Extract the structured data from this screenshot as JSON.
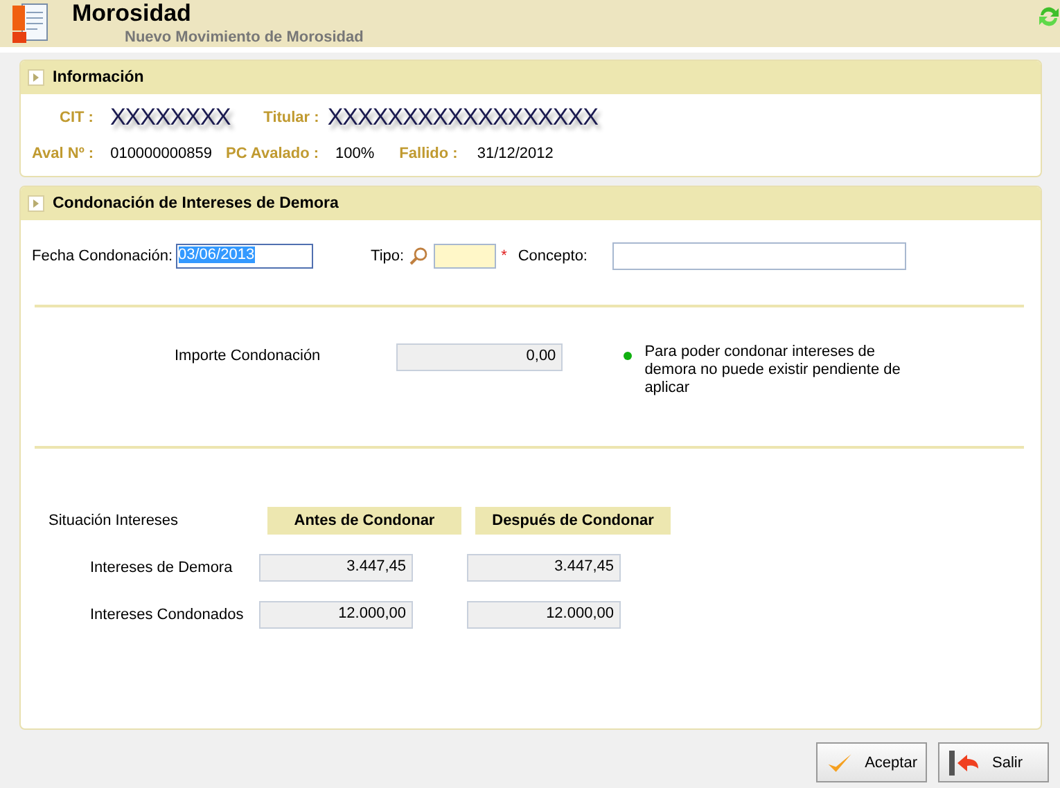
{
  "header": {
    "title": "Morosidad",
    "subtitle": "Nuevo Movimiento de Morosidad"
  },
  "info": {
    "title": "Información",
    "expanded": true,
    "row1": [
      {
        "label": "CIT :",
        "value": "XXXXXXXX"
      },
      {
        "label": "Titular :",
        "value": "XXXXXXXXXXXXXXXXXX"
      }
    ],
    "row2": [
      {
        "label": "Aval Nº :",
        "value": "010000000859"
      },
      {
        "label": "PC Avalado :",
        "value": "100%"
      },
      {
        "label": "Fallido :",
        "value": "31/12/2012"
      }
    ]
  },
  "condonacion": {
    "title": "Condonación de Intereses de Demora",
    "expanded": true,
    "fecha": {
      "label": "Fecha Condonación:",
      "value": "03/06/2013"
    },
    "tipo": {
      "label": "Tipo:",
      "required_mark": "*"
    },
    "concepto": {
      "label": "Concepto:"
    },
    "importe": {
      "label": "Importe Condonación",
      "value": "0,00"
    },
    "note": "Para poder condonar intereses de demora no puede existir pendiente de aplicar",
    "situacion": {
      "label": "Situación Intereses",
      "columns": [
        "Antes de Condonar",
        "Después de Condonar"
      ],
      "rows": [
        {
          "label": "Intereses de Demora",
          "values": [
            "3.447,45",
            "3.447,45"
          ]
        },
        {
          "label": "Intereses Condonados",
          "values": [
            "12.000,00",
            "12.000,00"
          ]
        }
      ]
    }
  },
  "buttons": [
    {
      "label": "Aceptar",
      "kind": "accept"
    },
    {
      "label": "Salir",
      "kind": "exit"
    }
  ]
}
